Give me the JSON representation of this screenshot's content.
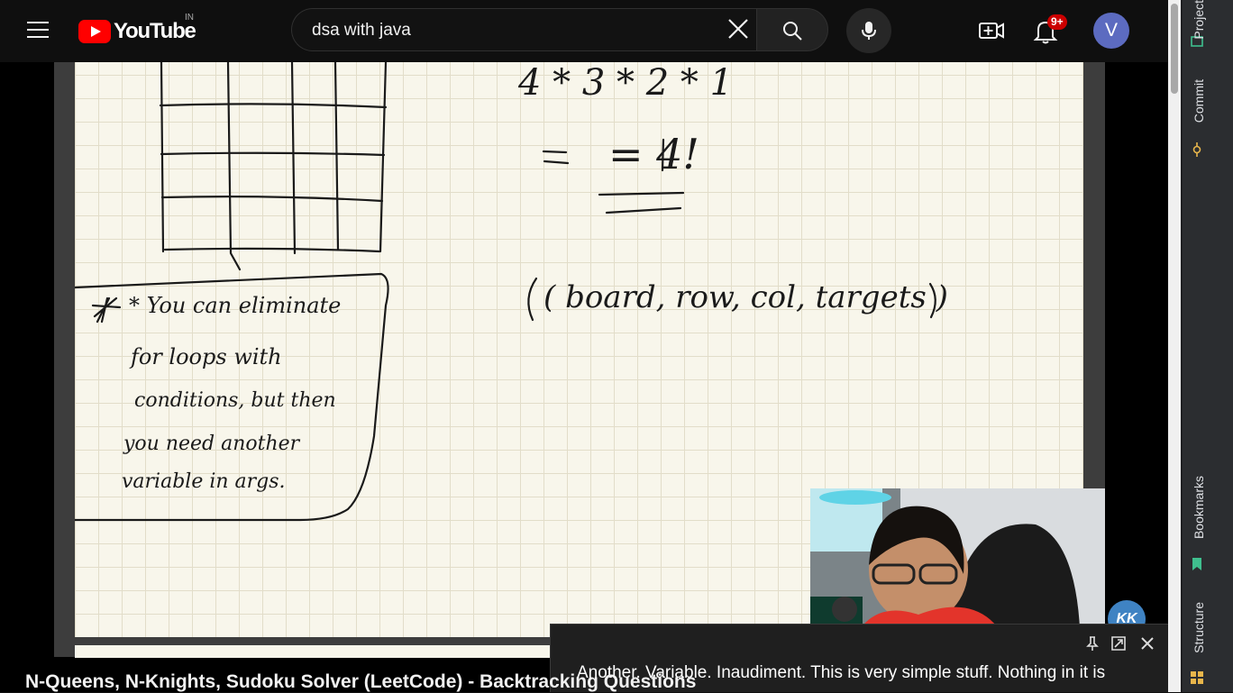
{
  "header": {
    "logo_text": "YouTube",
    "region_code": "IN",
    "search_value": "dsa with java",
    "notification_count": "9+",
    "avatar_letter": "V"
  },
  "video": {
    "title": "N-Queens, N-Knights, Sudoku Solver (LeetCode) - Backtracking Questions",
    "caption": "Another. Variable. Inaudiment. This is very simple stuff. Nothing in it is",
    "channel_badge": "KK"
  },
  "whiteboard": {
    "line1": "4 * 3 * 2 * 1",
    "line2": "= 4!",
    "params": "( board, row, col, targets )",
    "note": [
      "* You can eliminate",
      "for loops with",
      "conditions, but then",
      "you need another",
      "variable in args."
    ]
  },
  "ide": {
    "tabs": [
      "Project",
      "Commit",
      "Bookmarks",
      "Structure"
    ]
  },
  "colors": {
    "brand_red": "#ff0000",
    "badge_red": "#cc0000",
    "avatar": "#5c6bc0",
    "paper": "#f8f6eb"
  }
}
